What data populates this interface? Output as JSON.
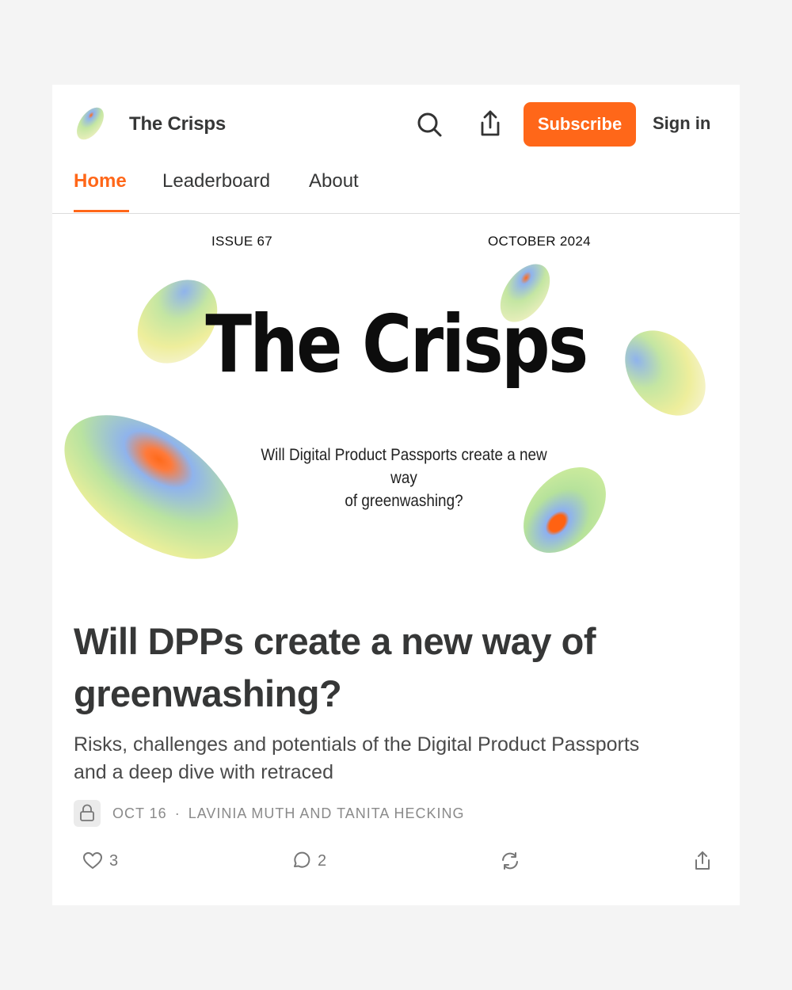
{
  "header": {
    "publication_name": "The Crisps",
    "subscribe_label": "Subscribe",
    "signin_label": "Sign in",
    "accent_color": "#ff6719"
  },
  "tabs": [
    {
      "label": "Home",
      "active": true
    },
    {
      "label": "Leaderboard",
      "active": false
    },
    {
      "label": "About",
      "active": false
    }
  ],
  "cover": {
    "issue": "ISSUE 67",
    "date": "OCTOBER 2024",
    "title": "The Crisps",
    "subtitle_line1": "Will Digital Product Passports create a new way",
    "subtitle_line2": "of greenwashing?"
  },
  "post": {
    "headline_line1": "Will DPPs create a new way of",
    "headline_line2": "greenwashing?",
    "subtitle_line1": "Risks, challenges and potentials of the Digital Product Passports",
    "subtitle_line2": "and a deep dive with retraced",
    "date": "OCT 16",
    "separator": "·",
    "authors": "LAVINIA MUTH AND TANITA HECKING",
    "likes": "3",
    "comments": "2"
  },
  "icons": {
    "search": "search-icon",
    "share": "share-icon",
    "lock": "lock-icon",
    "like": "heart-icon",
    "comment": "comment-icon",
    "restack": "restack-icon",
    "post_share": "share-icon"
  }
}
